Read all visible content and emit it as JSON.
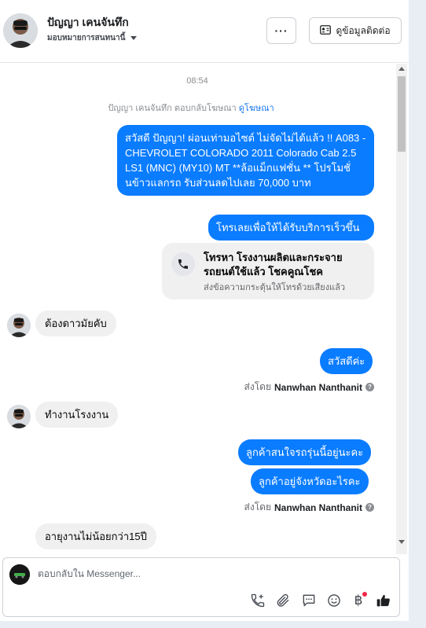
{
  "header": {
    "name": "ปัญญา เคนจันทึก",
    "assignment": "มอบหมายการสนทนานี้",
    "more_label": "···",
    "contact_label": "ดูข้อมูลติดต่อ"
  },
  "conversation": {
    "timestamp": "08:54",
    "system_prefix": "ปัญญา เคนจันทึก ตอบกลับโฆษณา",
    "system_link": "ดูโฆษณา",
    "msg1": "สวัสดี ปัญญา! ผ่อนเท่ามอไซต์ ไม่จัดไม่ได้แล้ว !! A083 - CHEVROLET COLORADO 2011 Colorado Cab 2.5 LS1 (MNC) (MY10) MT **ล้อแม็กแฟชั่น ** โปรโมชั่นข้าวแลกรถ รับส่วนลดไปเลย 70,000 บาท",
    "msg2": "โทรเลยเพื่อให้ได้รับบริการเร็วขึ้น",
    "call_title": "โทรหา โรงงานผลิตและกระจายรถยนต์ใช้แล้ว โชคคูณโชค",
    "call_sub": "ส่งข้อความกระตุ้นให้โทรด้วยเสียงแล้ว",
    "in1": "ต้องดาวมัยคับ",
    "out_hello": "สวัสดีค่ะ",
    "sent_by_prefix": "ส่งโดย",
    "sender": "Nanwhan Nanthanit",
    "in2": "ทำงานโรงงาน",
    "out3": "ลูกค้าสนใจรถรุ่นนี้อยู่นะคะ",
    "out4": "ลูกค้าอยู่จังหวัดอะไรคะ",
    "sent_by_prefix2": "ส่งโดย",
    "sender2": "Nanwhan Nanthanit",
    "in3": "อายุงานไม่น้อยกว่า15ปี"
  },
  "composer": {
    "placeholder": "ตอบกลับใน Messenger..."
  },
  "colors": {
    "outgoing_bubble": "#0a7cff",
    "incoming_bubble": "#f0f0f0",
    "link": "#1877f2",
    "like": "#1c1e21"
  },
  "icons": {
    "add_call": "add-call-icon",
    "attach": "paperclip-icon",
    "saved_reply": "chat-bubble-icon",
    "emoji": "smiley-icon",
    "payment": "baht-icon",
    "like": "thumbs-up-icon"
  }
}
